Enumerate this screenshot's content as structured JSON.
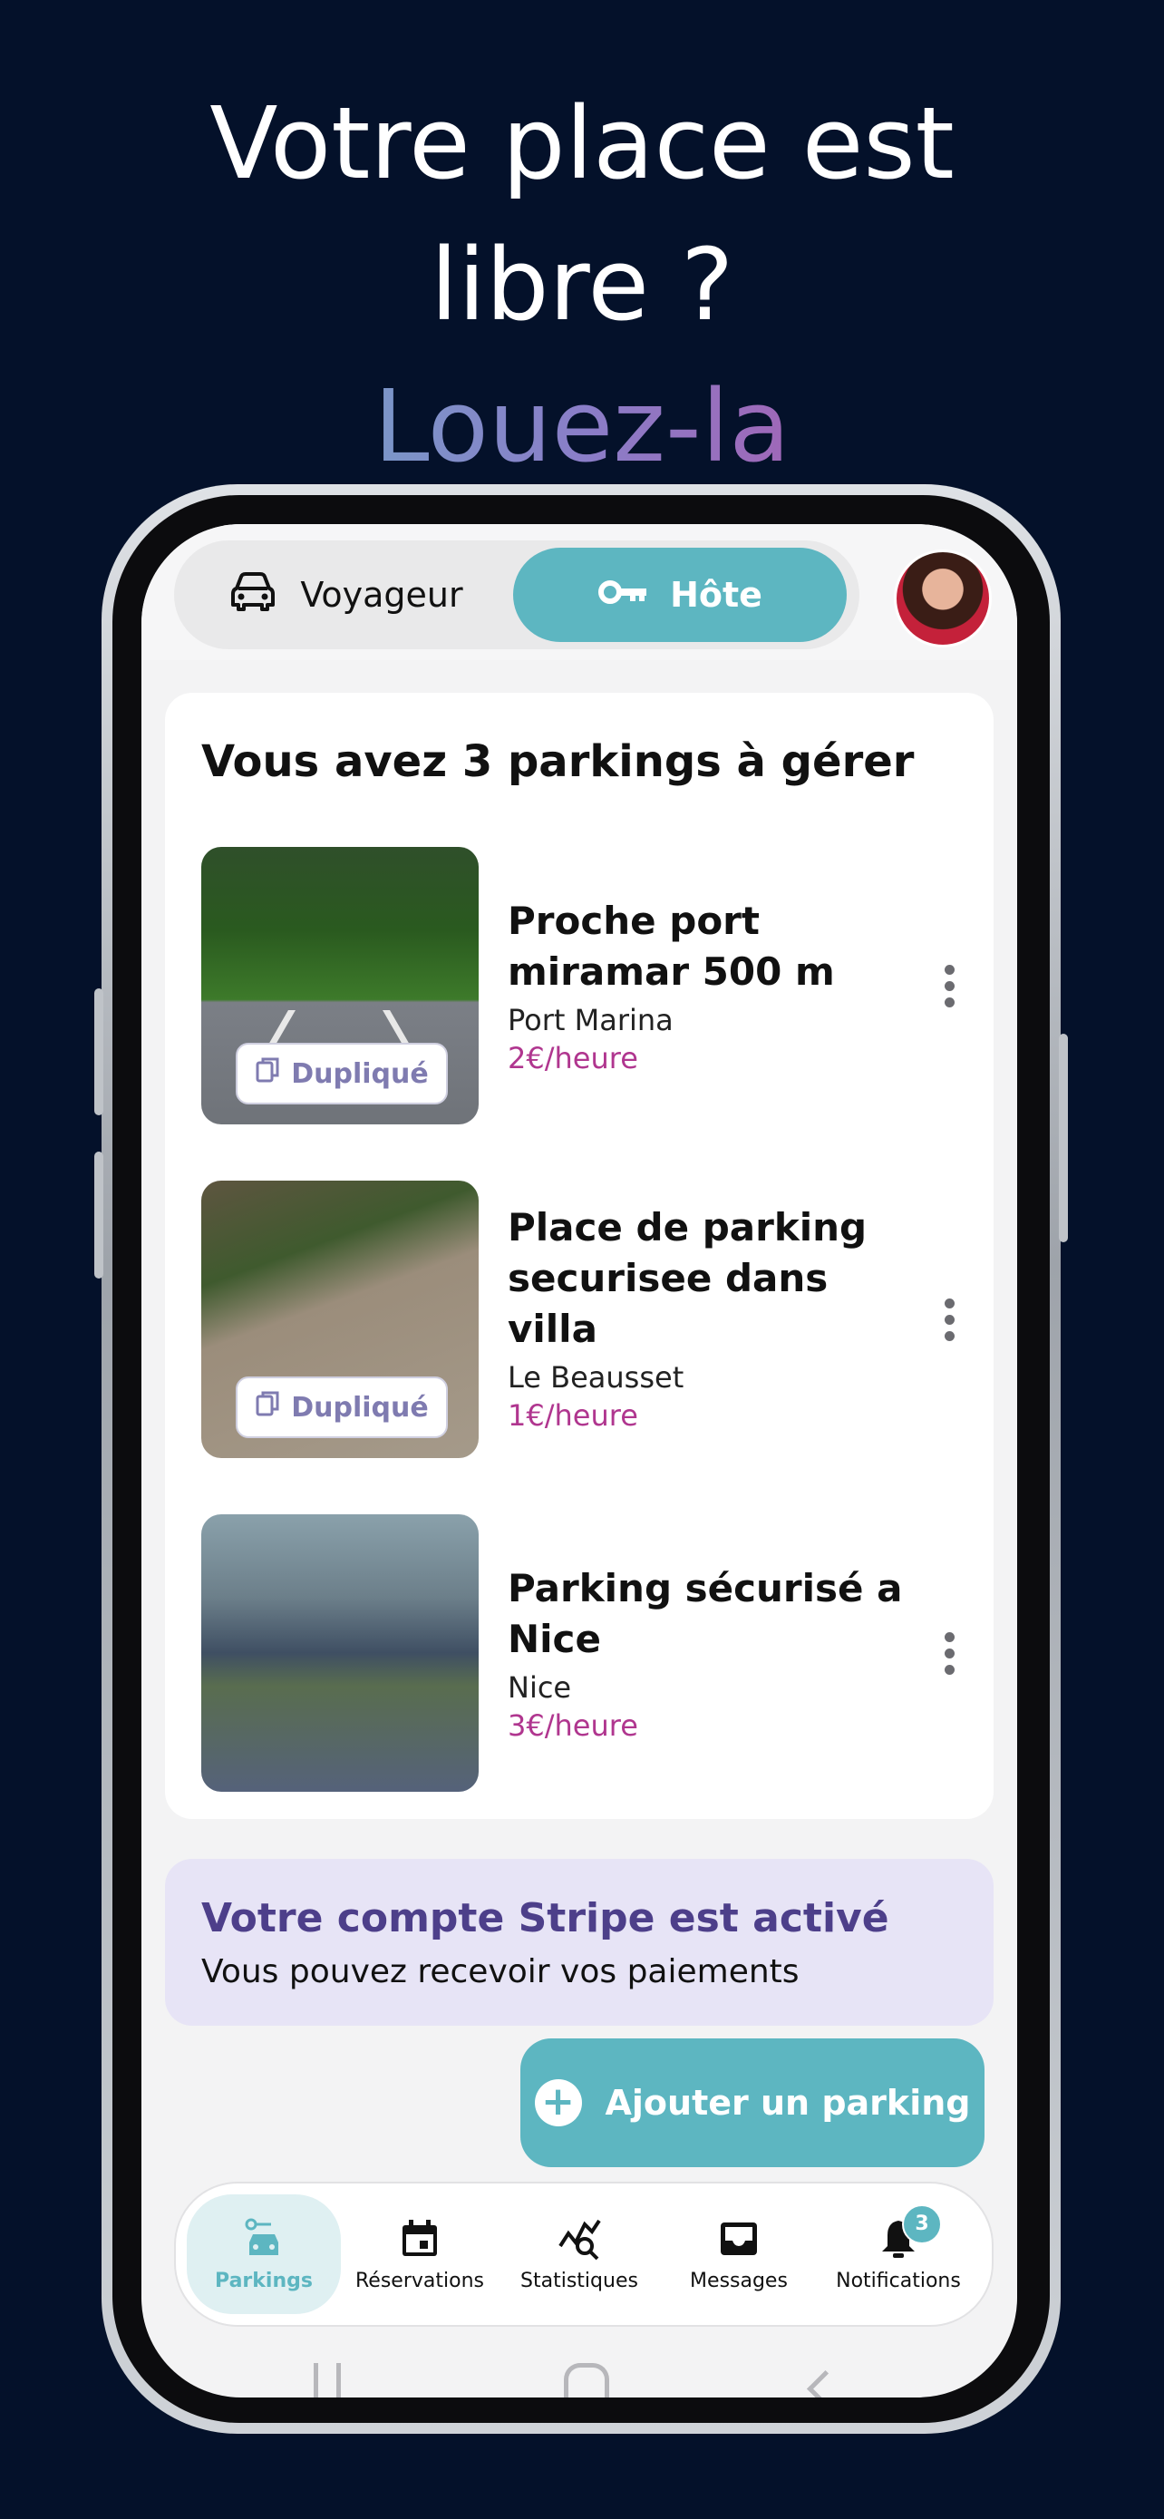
{
  "headline": {
    "line1": "Votre place est",
    "line2": "libre ?",
    "accent": "Louez-la"
  },
  "toggle": {
    "traveler_label": "Voyageur",
    "host_label": "Hôte",
    "active": "host"
  },
  "main": {
    "title": "Vous avez 3 parkings à gérer",
    "parkings": [
      {
        "title": "Proche port miramar 500 m",
        "location": "Port Marina",
        "price": "2€/heure",
        "badge": "Dupliqué"
      },
      {
        "title": "Place de parking securisee dans villa",
        "location": "Le Beausset",
        "price": "1€/heure",
        "badge": "Dupliqué"
      },
      {
        "title": "Parking sécurisé a Nice",
        "location": "Nice",
        "price": "3€/heure"
      }
    ]
  },
  "stripe": {
    "title": "Votre compte Stripe est activé",
    "subtitle": "Vous pouvez recevoir vos paiements"
  },
  "fab": {
    "label": "Ajouter un parking"
  },
  "bottom_nav": {
    "items": [
      {
        "label": "Parkings",
        "icon": "car-key-icon",
        "active": true
      },
      {
        "label": "Réservations",
        "icon": "calendar-icon"
      },
      {
        "label": "Statistiques",
        "icon": "chart-search-icon"
      },
      {
        "label": "Messages",
        "icon": "inbox-icon"
      },
      {
        "label": "Notifications",
        "icon": "bell-icon",
        "badge": "3"
      }
    ]
  },
  "colors": {
    "background": "#04112a",
    "accent": "#5db6c1",
    "price": "#b0368f",
    "stripe_bg": "#e7e4f6",
    "stripe_title": "#4d3f8a"
  }
}
